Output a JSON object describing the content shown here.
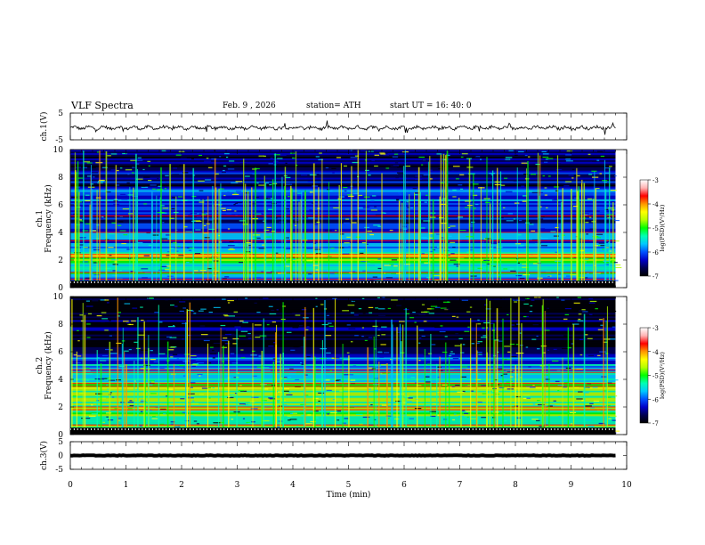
{
  "header": {
    "title": "VLF Spectra",
    "date": "Feb. 9 , 2026",
    "station": "station= ATH",
    "start_ut": "start UT = 16: 40: 0"
  },
  "colors": {
    "colormap": [
      "#000000",
      "#000050",
      "#0000c8",
      "#0050ff",
      "#00c8ff",
      "#00ffb4",
      "#00ff00",
      "#b4ff00",
      "#ffff00",
      "#ff9600",
      "#ff0000",
      "#ffb4b4",
      "#ffffff"
    ],
    "trace": "#000000"
  },
  "chart_data": [
    {
      "type": "line",
      "name": "ch1-waveform",
      "ylabel": "ch.1(V)",
      "ylim": [
        -5,
        5
      ],
      "yticks": [
        5,
        -5
      ],
      "xlim": [
        0,
        10
      ],
      "x_start": 0,
      "x_end": 9.8,
      "baseline": -0.5,
      "amplitude": 1.2
    },
    {
      "type": "heatmap",
      "name": "ch1-spectrogram",
      "ylabel": "ch.1\nFrequency (kHz)",
      "ylim": [
        0,
        10
      ],
      "yticks": [
        0,
        2,
        4,
        6,
        8,
        10
      ],
      "xlim": [
        0,
        10
      ],
      "x_end": 9.8,
      "colorbar": {
        "label": "log(PSD)(V²/Hz)",
        "range": [
          -7,
          -3
        ],
        "ticks": [
          "-3",
          "-4",
          "-5",
          "-6",
          "-7"
        ]
      },
      "bands": [
        {
          "f": [
            0,
            0.35
          ],
          "level": -6.9
        },
        {
          "f": [
            0.35,
            1.0
          ],
          "level": -5.6
        },
        {
          "f": [
            1.0,
            1.8
          ],
          "level": -5.4
        },
        {
          "f": [
            1.8,
            2.6
          ],
          "level": -4.8
        },
        {
          "f": [
            2.6,
            3.6
          ],
          "level": -5.9
        },
        {
          "f": [
            3.6,
            4.4
          ],
          "level": -6.0
        },
        {
          "f": [
            4.4,
            5.2
          ],
          "level": -6.4
        },
        {
          "f": [
            5.2,
            7.2
          ],
          "level": -6.1
        },
        {
          "f": [
            7.2,
            10.0
          ],
          "level": -6.5
        }
      ],
      "lines_khz": [
        0.6,
        1.1,
        2.2,
        2.4,
        3.4,
        4.0,
        5.2
      ],
      "sferic_density": 0.55,
      "sferic_reach_khz": [
        6.0,
        10.0
      ]
    },
    {
      "type": "heatmap",
      "name": "ch2-spectrogram",
      "ylabel": "ch.2\nFrequency (kHz)",
      "ylim": [
        0,
        10
      ],
      "yticks": [
        0,
        2,
        4,
        6,
        8,
        10
      ],
      "xlim": [
        0,
        10
      ],
      "x_end": 9.8,
      "colorbar": {
        "label": "log(PSD)(V²/Hz)",
        "range": [
          -7,
          -3
        ],
        "ticks": [
          "-3",
          "-4",
          "-5",
          "-6",
          "-7"
        ]
      },
      "bands": [
        {
          "f": [
            0,
            0.3
          ],
          "level": -6.9
        },
        {
          "f": [
            0.3,
            1.2
          ],
          "level": -5.2
        },
        {
          "f": [
            1.2,
            2.4
          ],
          "level": -4.9
        },
        {
          "f": [
            2.4,
            3.2
          ],
          "level": -5.1
        },
        {
          "f": [
            3.2,
            3.8
          ],
          "level": -4.6
        },
        {
          "f": [
            3.8,
            4.6
          ],
          "level": -5.5
        },
        {
          "f": [
            4.6,
            5.6
          ],
          "level": -5.9
        },
        {
          "f": [
            5.6,
            6.2
          ],
          "level": -6.4
        },
        {
          "f": [
            6.2,
            10.0
          ],
          "level": -6.9
        }
      ],
      "lines_khz": [
        0.7,
        1.8,
        2.0,
        3.5,
        3.7,
        4.5,
        4.7
      ],
      "sferic_density": 0.45,
      "sferic_reach_khz": [
        5.0,
        10.0
      ]
    },
    {
      "type": "line",
      "name": "ch3-waveform",
      "ylabel": "ch.3(V)",
      "ylim": [
        -5,
        5
      ],
      "yticks": [
        5,
        0,
        -5
      ],
      "xlim": [
        0,
        10
      ],
      "x_start": 0,
      "x_end": 9.8,
      "baseline": 0,
      "amplitude": 0.2,
      "xlabel": "Time (min)",
      "xticks": [
        0,
        1,
        2,
        3,
        4,
        5,
        6,
        7,
        8,
        9,
        10
      ]
    }
  ]
}
